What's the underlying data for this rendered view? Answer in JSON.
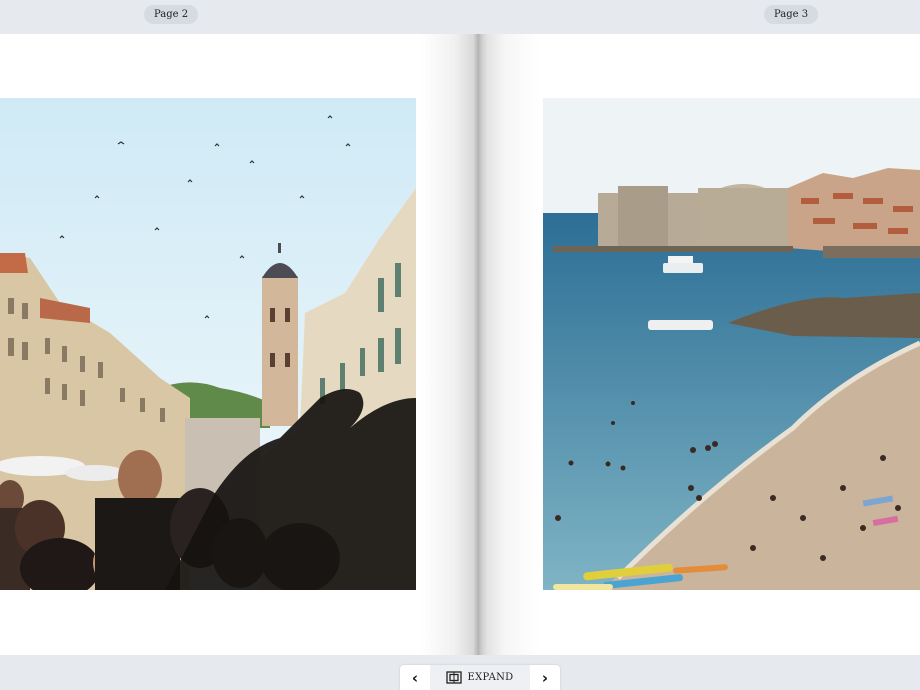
{
  "pages": {
    "left_label": "Page 2",
    "right_label": "Page 3"
  },
  "toolbar": {
    "prev_icon": "chevron-left-icon",
    "next_icon": "chevron-right-icon",
    "expand_icon": "expand-icon",
    "expand_label": "EXPAND"
  },
  "colors": {
    "background": "#e6e9ee",
    "page": "#ffffff",
    "label_pill": "#d6dbe2"
  }
}
